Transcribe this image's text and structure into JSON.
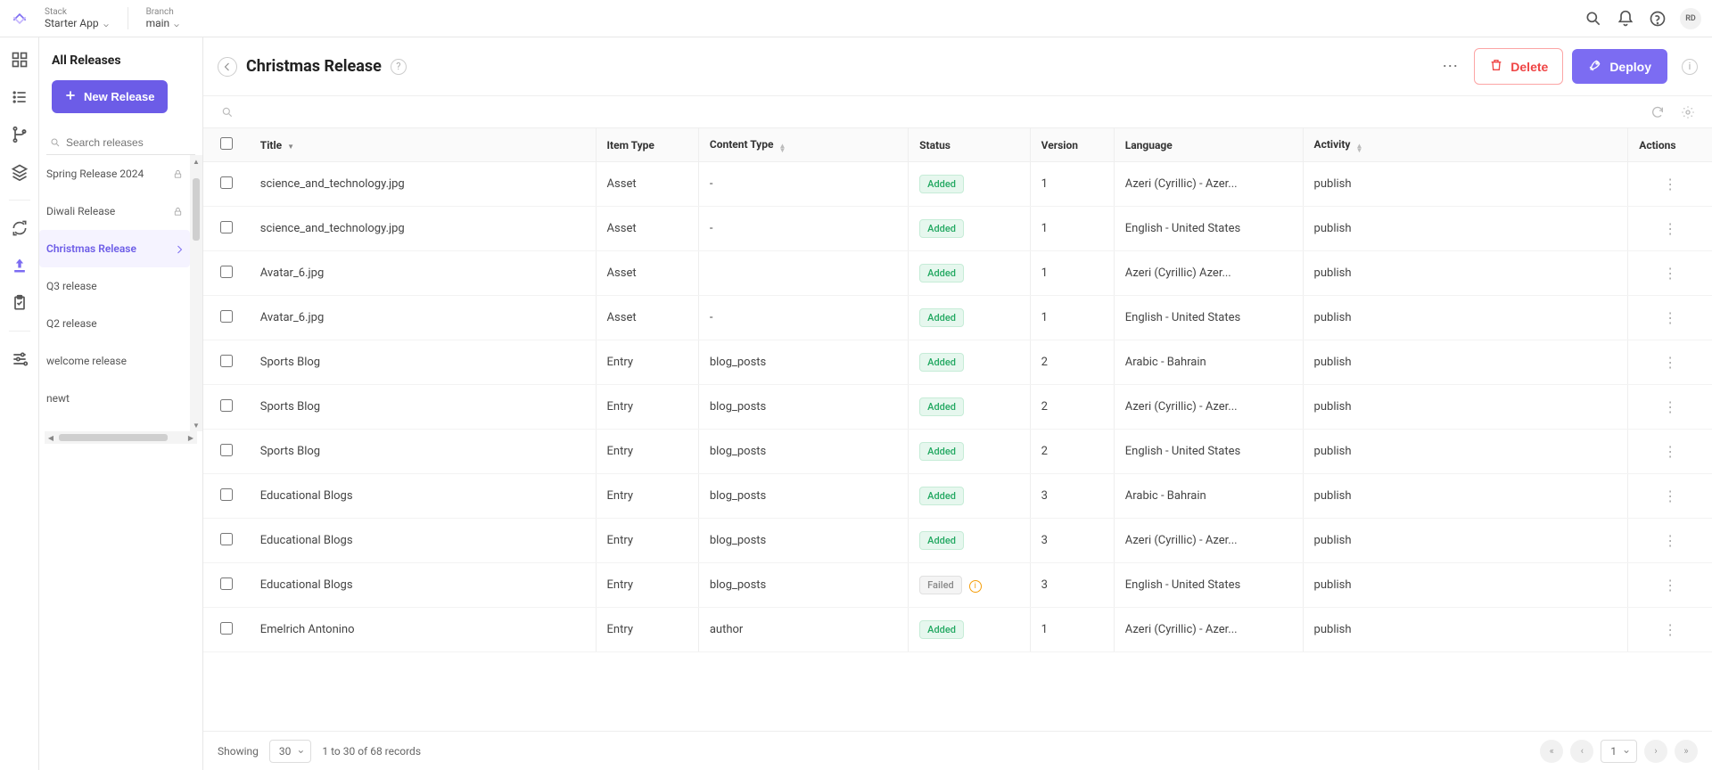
{
  "topbar": {
    "stack_label": "Stack",
    "stack_value": "Starter App",
    "branch_label": "Branch",
    "branch_value": "main",
    "avatar_initials": "RD"
  },
  "release_panel": {
    "title": "All Releases",
    "new_release_label": "New Release",
    "search_placeholder": "Search releases",
    "items": [
      {
        "label": "Spring Release 2024",
        "locked": true,
        "active": false
      },
      {
        "label": "Diwali Release",
        "locked": true,
        "active": false
      },
      {
        "label": "Christmas Release",
        "locked": false,
        "active": true
      },
      {
        "label": "Q3 release",
        "locked": false,
        "active": false
      },
      {
        "label": "Q2 release",
        "locked": false,
        "active": false
      },
      {
        "label": "welcome release",
        "locked": false,
        "active": false
      },
      {
        "label": "newt",
        "locked": false,
        "active": false
      }
    ]
  },
  "content_header": {
    "title": "Christmas Release",
    "delete_label": "Delete",
    "deploy_label": "Deploy"
  },
  "table": {
    "columns": {
      "title": "Title",
      "item_type": "Item Type",
      "content_type": "Content Type",
      "status": "Status",
      "version": "Version",
      "language": "Language",
      "activity": "Activity",
      "actions": "Actions"
    },
    "rows": [
      {
        "title": "science_and_technology.jpg",
        "item_type": "Asset",
        "content_type": "-",
        "status": "Added",
        "version": "1",
        "language": "Azeri (Cyrillic) - Azer...",
        "activity": "publish"
      },
      {
        "title": "science_and_technology.jpg",
        "item_type": "Asset",
        "content_type": "-",
        "status": "Added",
        "version": "1",
        "language": "English - United States",
        "activity": "publish"
      },
      {
        "title": "Avatar_6.jpg",
        "item_type": "Asset",
        "content_type": "",
        "status": "Added",
        "version": "1",
        "language": "Azeri (Cyrillic)    Azer...",
        "activity": "publish"
      },
      {
        "title": "Avatar_6.jpg",
        "item_type": "Asset",
        "content_type": "-",
        "status": "Added",
        "version": "1",
        "language": "English - United States",
        "activity": "publish"
      },
      {
        "title": "Sports Blog",
        "item_type": "Entry",
        "content_type": "blog_posts",
        "status": "Added",
        "version": "2",
        "language": "Arabic - Bahrain",
        "activity": "publish"
      },
      {
        "title": "Sports Blog",
        "item_type": "Entry",
        "content_type": "blog_posts",
        "status": "Added",
        "version": "2",
        "language": "Azeri (Cyrillic) - Azer...",
        "activity": "publish"
      },
      {
        "title": "Sports Blog",
        "item_type": "Entry",
        "content_type": "blog_posts",
        "status": "Added",
        "version": "2",
        "language": "English - United States",
        "activity": "publish"
      },
      {
        "title": "Educational Blogs",
        "item_type": "Entry",
        "content_type": "blog_posts",
        "status": "Added",
        "version": "3",
        "language": "Arabic - Bahrain",
        "activity": "publish"
      },
      {
        "title": "Educational Blogs",
        "item_type": "Entry",
        "content_type": "blog_posts",
        "status": "Added",
        "version": "3",
        "language": "Azeri (Cyrillic) - Azer...",
        "activity": "publish"
      },
      {
        "title": "Educational Blogs",
        "item_type": "Entry",
        "content_type": "blog_posts",
        "status": "Failed",
        "version": "3",
        "language": "English - United States",
        "activity": "publish"
      },
      {
        "title": "Emelrich Antonino",
        "item_type": "Entry",
        "content_type": "author",
        "status": "Added",
        "version": "1",
        "language": "Azeri (Cyrillic) - Azer...",
        "activity": "publish"
      }
    ]
  },
  "footer": {
    "showing_label": "Showing",
    "page_size": "30",
    "records_text": "1 to 30 of 68 records",
    "current_page": "1"
  }
}
